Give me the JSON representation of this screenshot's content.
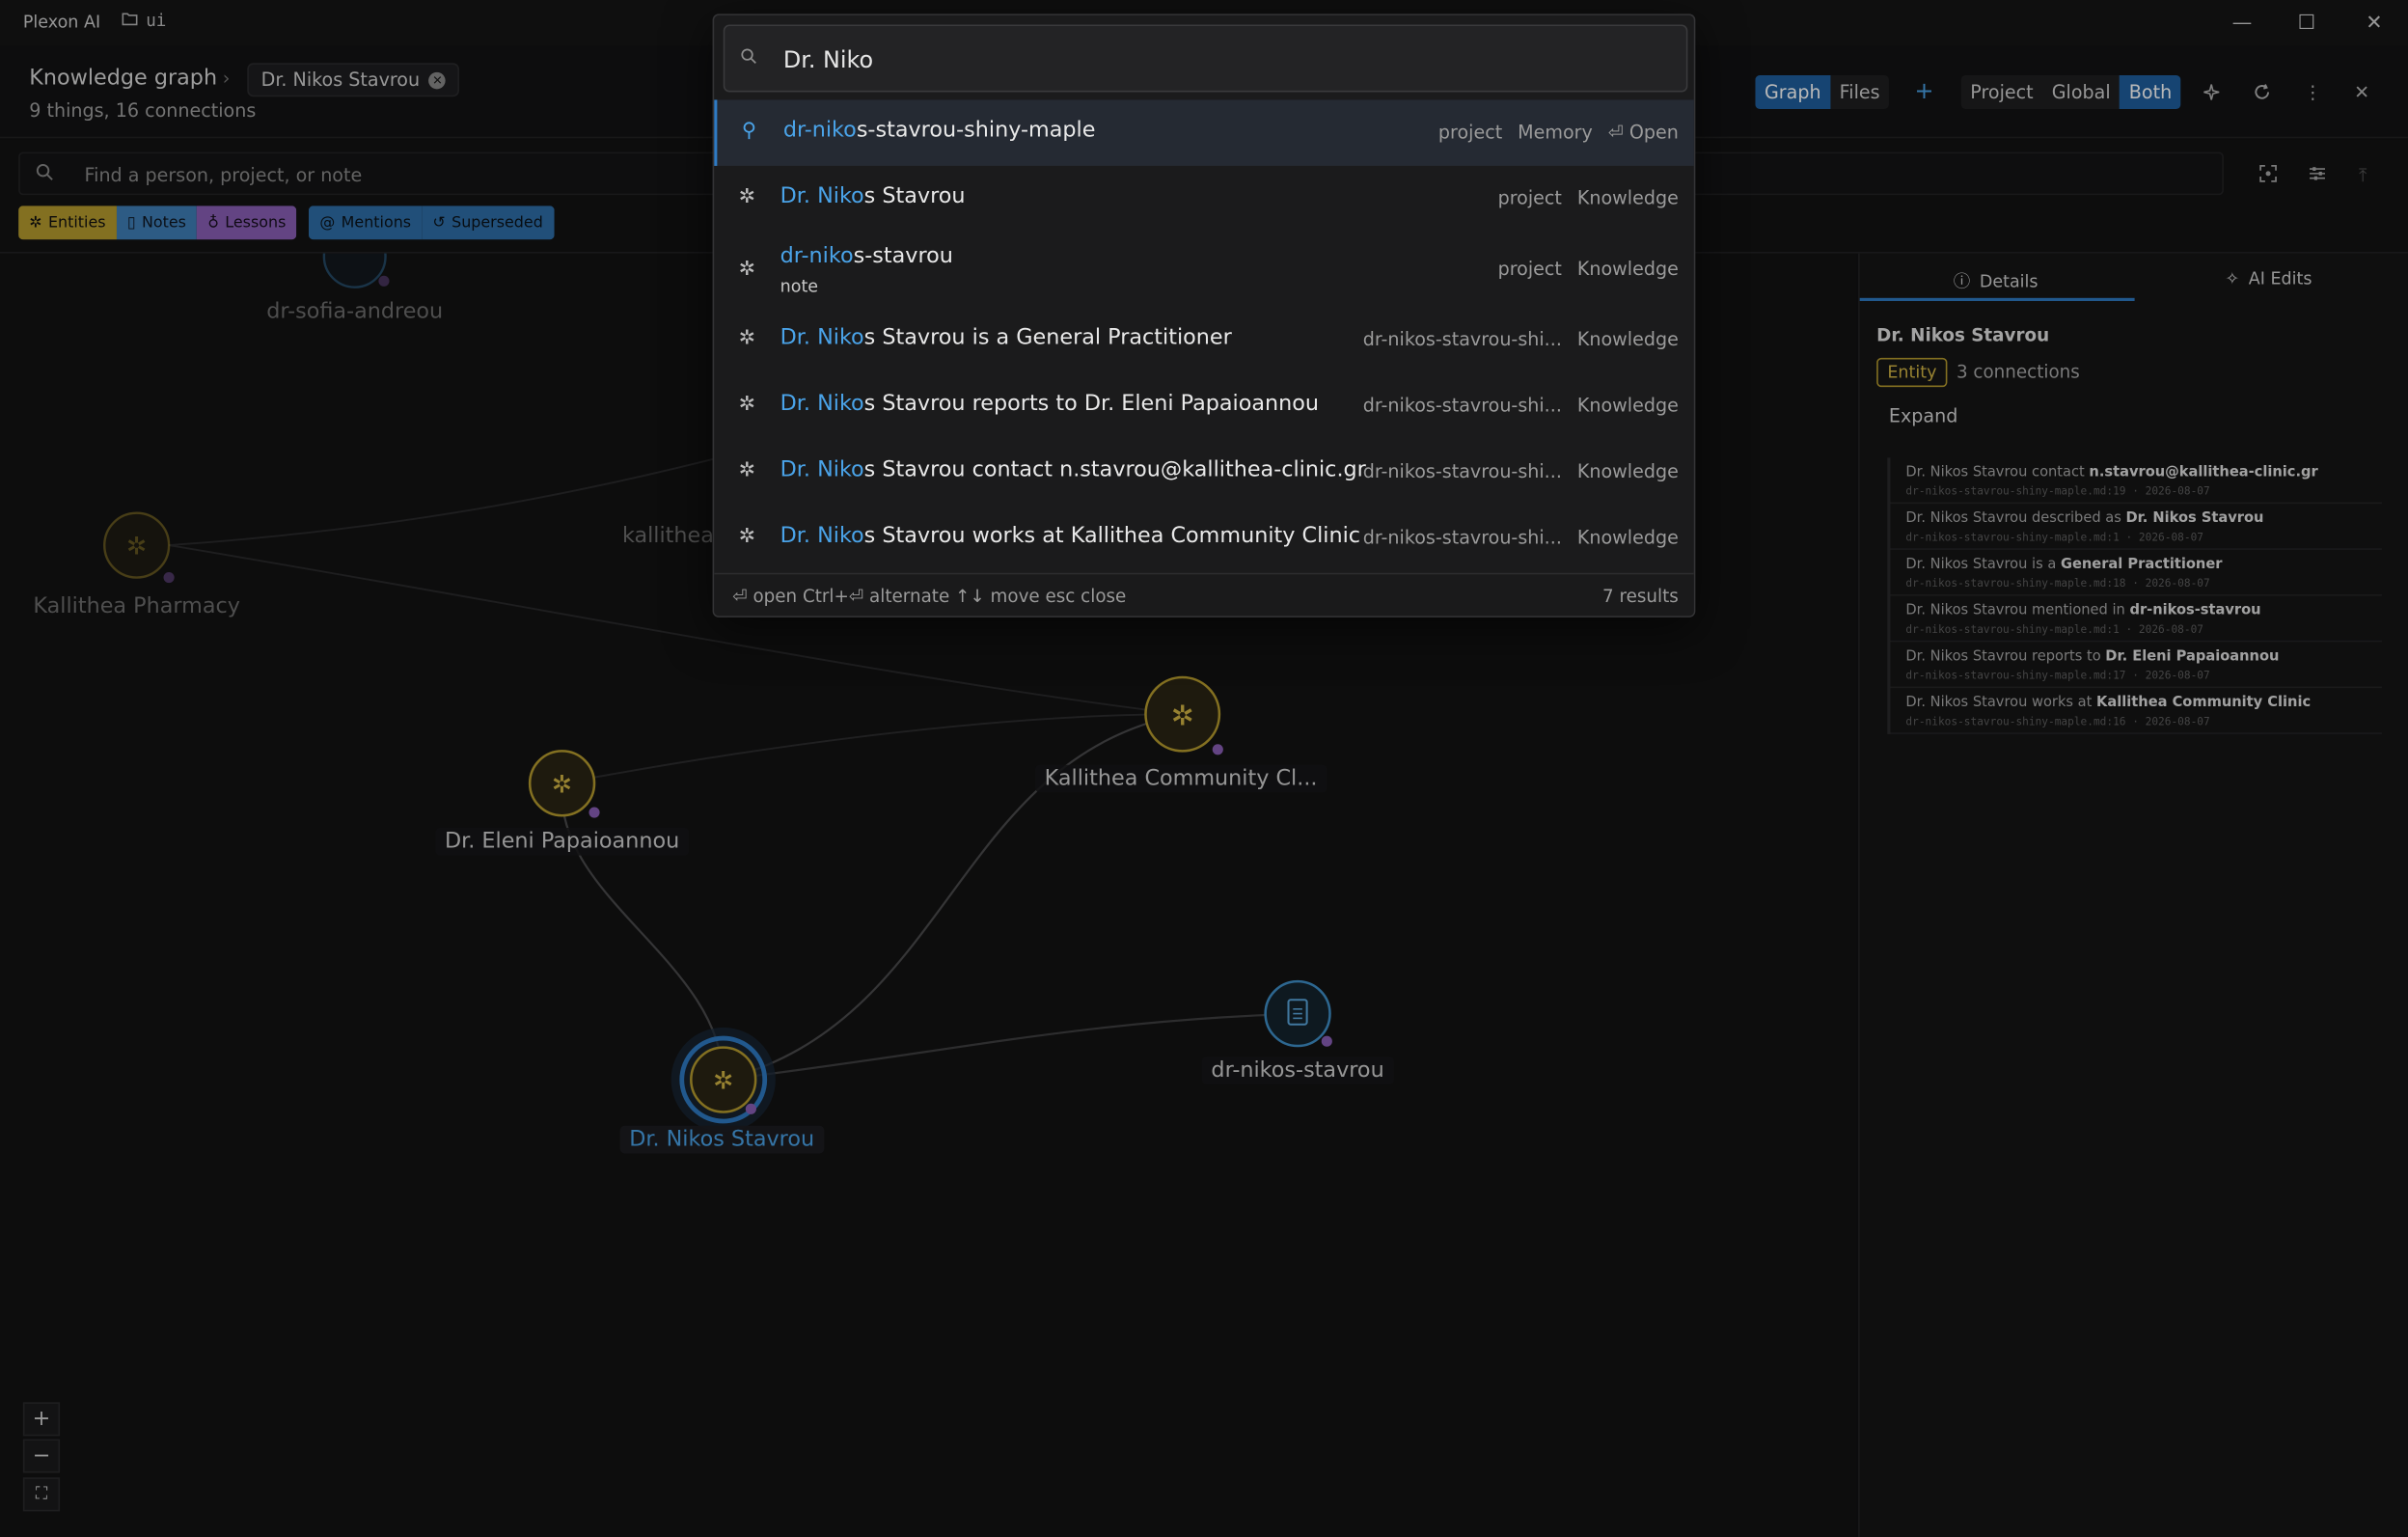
{
  "titlebar": {
    "app_name": "Plexon AI",
    "project": "ui",
    "minimize": "—",
    "maximize": "☐",
    "close": "✕"
  },
  "header": {
    "title": "Knowledge graph",
    "breadcrumb_sep": "›",
    "breadcrumb_chip": "Dr. Nikos Stavrou",
    "subtitle": "9 things, 16 connections",
    "view_tabs": [
      "Graph",
      "Files"
    ],
    "active_view": "Graph",
    "add": "+",
    "scope_tabs": [
      "Project",
      "Global",
      "Both"
    ],
    "active_scope": "Both"
  },
  "search": {
    "placeholder": "Find a person, project, or note"
  },
  "filters": {
    "group1": [
      {
        "label": "Entities"
      },
      {
        "label": "Notes"
      },
      {
        "label": "Lessons"
      }
    ],
    "group2": [
      {
        "label": "Mentions"
      },
      {
        "label": "Superseded"
      }
    ]
  },
  "graph": {
    "nodes": [
      {
        "label": "dr-sofia-andreou",
        "kind": "note",
        "dim": true
      },
      {
        "label": "Kallithea Pharmacy",
        "kind": "entity",
        "dim": true
      },
      {
        "label": "kallithea",
        "kind": "label",
        "dim": true
      },
      {
        "label": "Dr. Eleni Papaioannou",
        "kind": "entity"
      },
      {
        "label": "Kallithea Community Cl...",
        "kind": "entity"
      },
      {
        "label": "dr-nikos-stavrou",
        "kind": "note"
      },
      {
        "label": "Dr. Nikos Stavrou",
        "kind": "entity",
        "selected": true
      }
    ],
    "zoom": [
      "+",
      "−",
      "⛶"
    ]
  },
  "panel": {
    "tabs": [
      "Details",
      "AI Edits"
    ],
    "active_tab": "Details",
    "name": "Dr. Nikos Stavrou",
    "badge": "Entity",
    "connections": "3 connections",
    "expand": "Expand",
    "facts": [
      {
        "subject": "Dr. Nikos Stavrou",
        "predicate": "contact",
        "object": "n.stavrou@kallithea-clinic.gr",
        "meta": "dr-nikos-stavrou-shiny-maple.md:19 · 2026-08-07"
      },
      {
        "subject": "Dr. Nikos Stavrou",
        "predicate": "described as",
        "object": "Dr. Nikos Stavrou",
        "meta": "dr-nikos-stavrou-shiny-maple.md:1 · 2026-08-07"
      },
      {
        "subject": "Dr. Nikos Stavrou",
        "predicate": "is a",
        "object": "General Practitioner",
        "meta": "dr-nikos-stavrou-shiny-maple.md:18 · 2026-08-07"
      },
      {
        "subject": "Dr. Nikos Stavrou",
        "predicate": "mentioned in",
        "object": "dr-nikos-stavrou",
        "meta": "dr-nikos-stavrou-shiny-maple.md:1 · 2026-08-07"
      },
      {
        "subject": "Dr. Nikos Stavrou",
        "predicate": "reports to",
        "object": "Dr. Eleni Papaioannou",
        "meta": "dr-nikos-stavrou-shiny-maple.md:17 · 2026-08-07"
      },
      {
        "subject": "Dr. Nikos Stavrou",
        "predicate": "works at",
        "object": "Kallithea Community Clinic",
        "meta": "dr-nikos-stavrou-shiny-maple.md:16 · 2026-08-07"
      }
    ]
  },
  "palette": {
    "query": "Dr. Niko",
    "results": [
      {
        "hl": "dr-niko",
        "rest": "s-stavrou-shiny-maple",
        "sub": "",
        "meta": [
          "project",
          "Memory",
          "⏎ Open"
        ],
        "icon": "memory-pin-icon"
      },
      {
        "hl": "Dr. Niko",
        "rest": "s Stavrou",
        "sub": "",
        "meta": [
          "project",
          "Knowledge"
        ],
        "icon": "entity-icon"
      },
      {
        "hl": "dr-niko",
        "rest": "s-stavrou",
        "sub": "note",
        "meta": [
          "project",
          "Knowledge"
        ],
        "icon": "entity-icon"
      },
      {
        "hl": "Dr. Niko",
        "rest": "s Stavrou is a General Practitioner",
        "sub": "",
        "meta": [
          "dr-nikos-stavrou-shi...",
          "Knowledge"
        ],
        "icon": "entity-icon"
      },
      {
        "hl": "Dr. Niko",
        "rest": "s Stavrou reports to Dr. Eleni Papaioannou",
        "sub": "",
        "meta": [
          "dr-nikos-stavrou-shi...",
          "Knowledge"
        ],
        "icon": "entity-icon"
      },
      {
        "hl": "Dr. Niko",
        "rest": "s Stavrou contact n.stavrou@kallithea-clinic.gr",
        "sub": "",
        "meta": [
          "dr-nikos-stavrou-shi...",
          "Knowledge"
        ],
        "icon": "entity-icon"
      },
      {
        "hl": "Dr. Niko",
        "rest": "s Stavrou works at Kallithea Community Clinic",
        "sub": "",
        "meta": [
          "dr-nikos-stavrou-shi...",
          "Knowledge"
        ],
        "icon": "entity-icon"
      }
    ],
    "hints": "⏎ open Ctrl+⏎ alternate ↑↓ move esc close",
    "count": "7 results"
  },
  "colors": {
    "accent": "#2f7bc4",
    "entity": "#b69b2f",
    "note": "#3f8fc8",
    "lesson": "#8a5fb6",
    "highlight": "#4aa3e8"
  }
}
